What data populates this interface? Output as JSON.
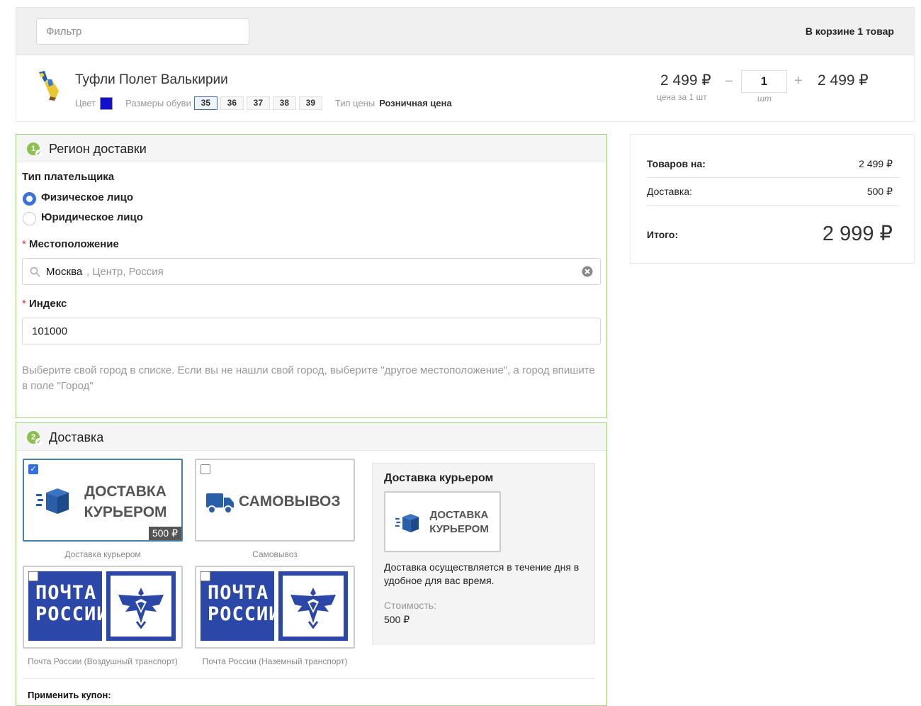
{
  "cart": {
    "filter_placeholder": "Фильтр",
    "count_text": "В корзине 1 товар",
    "item": {
      "name": "Туфли Полет Валькирии",
      "color_label": "Цвет",
      "color_value": "#1111cc",
      "sizes_label": "Размеры обуви",
      "sizes": [
        "35",
        "36",
        "37",
        "38",
        "39"
      ],
      "selected_size": "35",
      "price_type_label": "Тип цены",
      "price_type_value": "Розничная цена",
      "unit_price": "2 499 ₽",
      "unit_caption": "цена за 1 шт",
      "qty_minus": "−",
      "qty": "1",
      "qty_unit": "шт",
      "qty_plus": "+",
      "total": "2 499 ₽"
    }
  },
  "region": {
    "badge": "1",
    "title": "Регион доставки",
    "payer_label": "Тип плательщика",
    "payer_options": [
      "Физическое лицо",
      "Юридическое лицо"
    ],
    "payer_selected": "Физическое лицо",
    "location_label": "Местоположение",
    "location_city": "Москва",
    "location_rest": ", Центр, Россия",
    "index_label": "Индекс",
    "index_value": "101000",
    "hint": "Выберите свой город в списке. Если вы не нашли свой город, выберите \"другое местоположение\", а город впишите в поле \"Город\""
  },
  "delivery": {
    "badge": "2",
    "title": "Доставка",
    "options": [
      {
        "logo_line1": "ДОСТАВКА",
        "logo_line2": "КУРЬЕРОМ",
        "price": "500 ₽",
        "caption": "Доставка курьером",
        "checked": true
      },
      {
        "logo_text": "САМОВЫВОЗ",
        "caption": "Самовывоз",
        "checked": false
      },
      {
        "logo_line1": "ПОЧТА",
        "logo_line2": "РОССИИ",
        "caption": "Почта России (Воздушный транспорт)",
        "checked": false
      },
      {
        "logo_line1": "ПОЧТА",
        "logo_line2": "РОССИИ",
        "caption": "Почта России (Наземный транспорт)",
        "checked": false
      }
    ],
    "info": {
      "title": "Доставка курьером",
      "logo_line1": "ДОСТАВКА",
      "logo_line2": "КУРЬЕРОМ",
      "desc": "Доставка осуществляется в течение дня в удобное для вас время.",
      "cost_label": "Стоимость:",
      "cost_value": "500 ₽"
    },
    "coupon_label": "Применить купон:"
  },
  "summary": {
    "goods_label": "Товаров на:",
    "goods_value": "2 499 ₽",
    "delivery_label": "Доставка:",
    "delivery_value": "500 ₽",
    "total_label": "Итого:",
    "total_value": "2 999 ₽"
  },
  "colors": {
    "accent_green": "#8cc152",
    "radio_blue": "#3a73d9",
    "post_blue": "#2b47a8",
    "courier_blue": "#2a5fa8"
  }
}
